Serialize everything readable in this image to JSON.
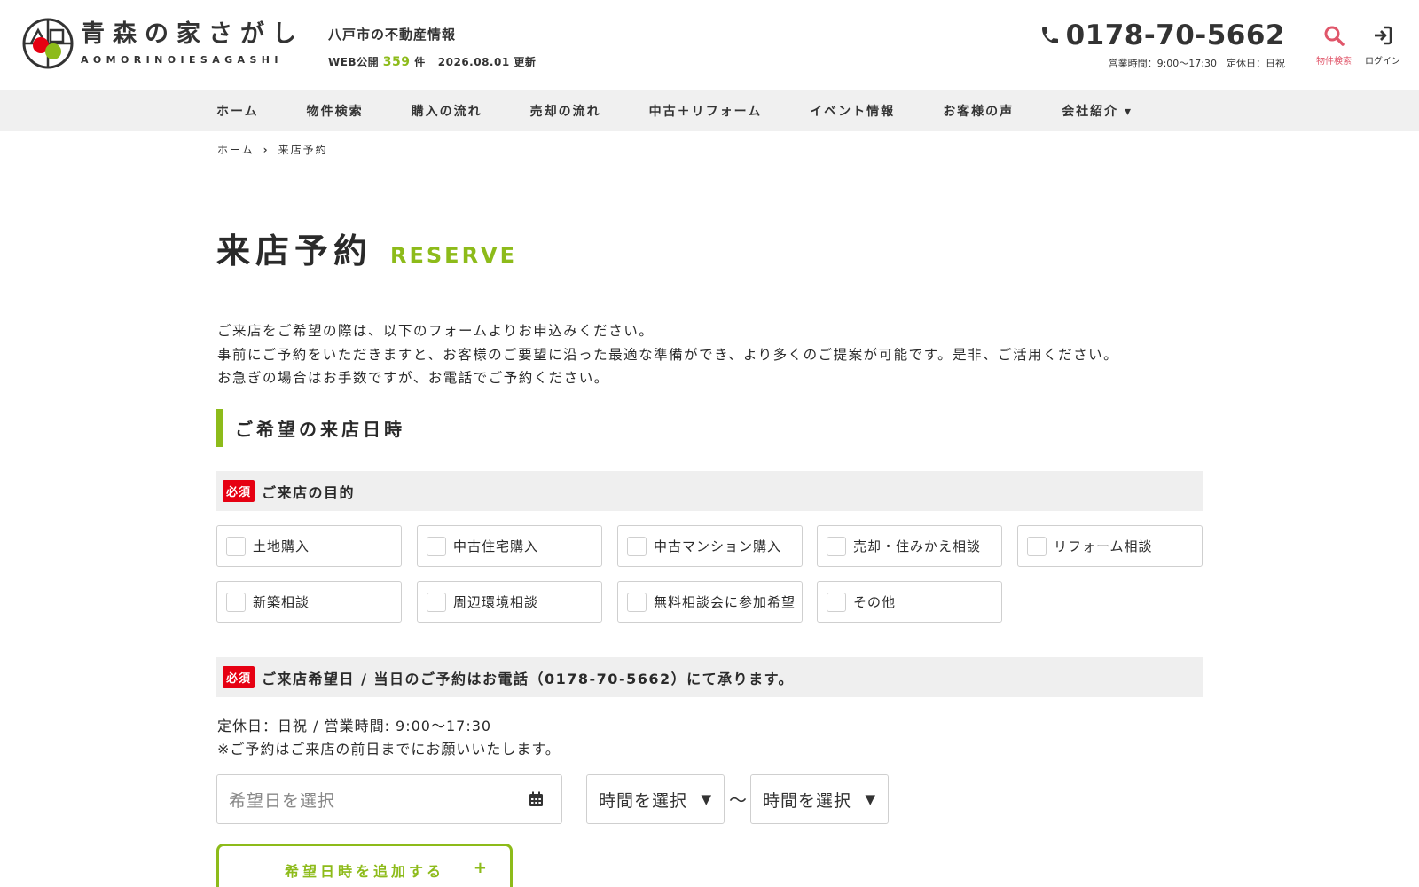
{
  "header": {
    "logo_jp": "青森の家さがし",
    "logo_en": "AOMORINOIESAGASHI",
    "tagline": "八戸市の不動産情報",
    "web_label": "WEB公開",
    "listing_count": "359",
    "count_unit": "件",
    "updated": "2026.08.01 更新",
    "phone": "0178-70-5662",
    "hours": "営業時間：9:00〜17:30　定休日：日祝",
    "search_label": "物件検索",
    "login_label": "ログイン"
  },
  "nav": {
    "items": [
      {
        "label": "ホーム"
      },
      {
        "label": "物件検索"
      },
      {
        "label": "購入の流れ"
      },
      {
        "label": "売却の流れ"
      },
      {
        "label": "中古＋リフォーム"
      },
      {
        "label": "イベント情報"
      },
      {
        "label": "お客様の声"
      },
      {
        "label": "会社紹介 ▾"
      }
    ]
  },
  "breadcrumb": {
    "home": "ホーム",
    "current": "来店予約"
  },
  "page": {
    "title_jp": "来店予約",
    "title_en": "RESERVE",
    "intro": [
      "ご来店をご希望の際は、以下のフォームよりお申込みください。",
      "事前にご予約をいただきますと、お客様のご要望に沿った最適な準備ができ、より多くのご提案が可能です。是非、ご活用ください。",
      "お急ぎの場合はお手数ですが、お電話でご予約ください。"
    ],
    "section_heading": "ご希望の来店日時"
  },
  "purpose": {
    "required": "必須",
    "label": "ご来店の目的",
    "options": [
      "土地購入",
      "中古住宅購入",
      "中古マンション購入",
      "売却・住みかえ相談",
      "リフォーム相談",
      "新築相談",
      "周辺環境相談",
      "無料相談会に参加希望",
      "その他"
    ]
  },
  "visit_date": {
    "required": "必須",
    "label": "ご来店希望日 / 当日のご予約はお電話（0178-70-5662）にて承ります。",
    "note_1": "定休日：日祝 / 営業時間: 9:00〜17:30",
    "note_2": "※ご予約はご来店の前日までにお願いいたします。",
    "date_placeholder": "希望日を選択",
    "time_start": "時間を選択",
    "time_end": "時間を選択",
    "tilde": "〜",
    "add_button": "希望日時を追加する",
    "add_icon": "+"
  },
  "colors": {
    "accent": "#8dbb1a",
    "required": "#e60012",
    "search_icon": "#e0566a"
  }
}
